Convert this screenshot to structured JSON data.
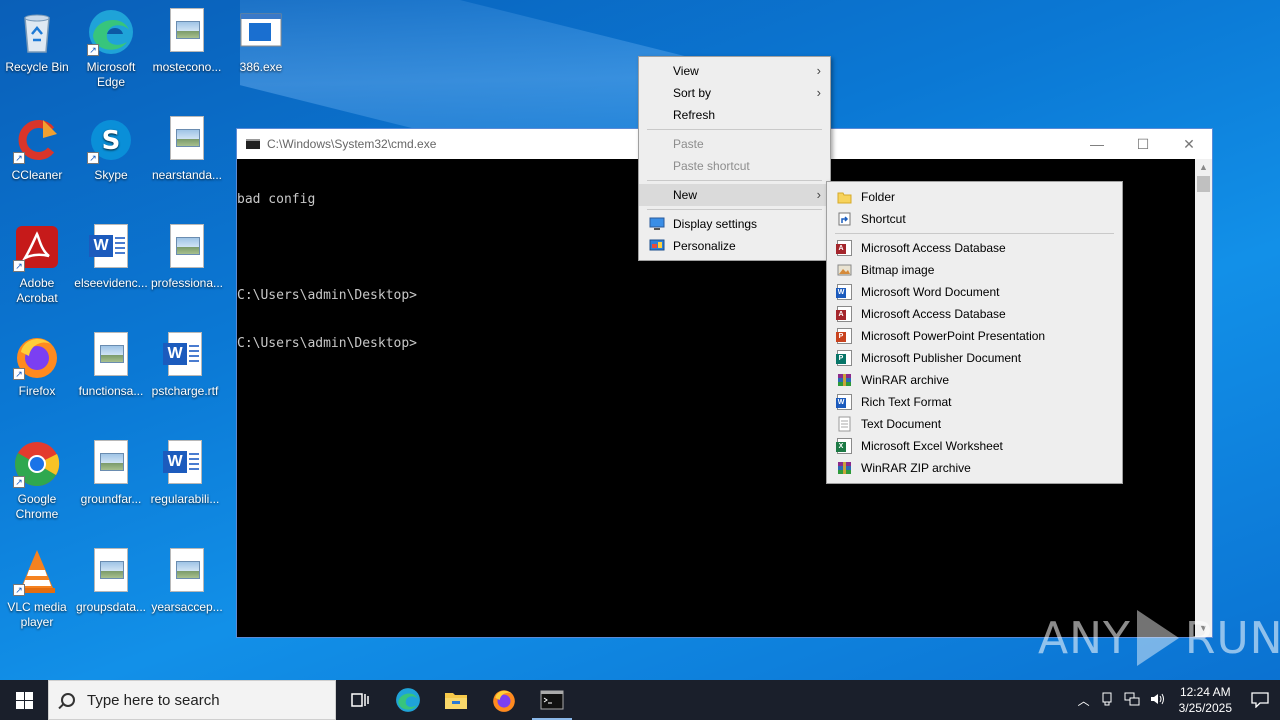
{
  "desktop": {
    "icons": [
      {
        "label": "Recycle Bin",
        "icon": "recycle-bin-icon"
      },
      {
        "label": "Microsoft Edge",
        "icon": "edge-icon"
      },
      {
        "label": "mostecono...",
        "icon": "image-file-icon"
      },
      {
        "label": "386.exe",
        "icon": "exe-window-icon"
      },
      {
        "label": "CCleaner",
        "icon": "ccleaner-icon"
      },
      {
        "label": "Skype",
        "icon": "skype-icon"
      },
      {
        "label": "nearstanda...",
        "icon": "image-file-icon"
      },
      {
        "label": "Adobe Acrobat",
        "icon": "acrobat-icon"
      },
      {
        "label": "elseevidenc...",
        "icon": "word-file-icon"
      },
      {
        "label": "professiona...",
        "icon": "image-file-icon"
      },
      {
        "label": "Firefox",
        "icon": "firefox-icon"
      },
      {
        "label": "functionsa...",
        "icon": "image-file-icon"
      },
      {
        "label": "pstcharge.rtf",
        "icon": "word-file-icon"
      },
      {
        "label": "Google Chrome",
        "icon": "chrome-icon"
      },
      {
        "label": "groundfar...",
        "icon": "image-file-icon"
      },
      {
        "label": "regularabili...",
        "icon": "word-file-icon"
      },
      {
        "label": "VLC media player",
        "icon": "vlc-icon"
      },
      {
        "label": "groupsdata...",
        "icon": "image-file-icon"
      },
      {
        "label": "yearsaccep...",
        "icon": "image-file-icon"
      }
    ]
  },
  "cmd": {
    "title": "C:\\Windows\\System32\\cmd.exe",
    "lines": [
      "bad config",
      "",
      "C:\\Users\\admin\\Desktop>",
      "C:\\Users\\admin\\Desktop>"
    ],
    "minimize": "—",
    "maximize": "☐",
    "close": "✕"
  },
  "context_menu": {
    "items": [
      {
        "label": "View",
        "submenu": true,
        "disabled": false
      },
      {
        "label": "Sort by",
        "submenu": true,
        "disabled": false
      },
      {
        "label": "Refresh",
        "submenu": false,
        "disabled": false
      },
      {
        "label": "Paste",
        "submenu": false,
        "disabled": true
      },
      {
        "label": "Paste shortcut",
        "submenu": false,
        "disabled": true
      },
      {
        "label": "New",
        "submenu": true,
        "disabled": false
      },
      {
        "label": "Display settings",
        "submenu": false,
        "disabled": false
      },
      {
        "label": "Personalize",
        "submenu": false,
        "disabled": false
      }
    ]
  },
  "new_submenu": {
    "items": [
      {
        "label": "Folder",
        "icon": "folder-icon"
      },
      {
        "label": "Shortcut",
        "icon": "shortcut-icon"
      },
      {
        "label": "Microsoft Access Database",
        "icon": "access-icon"
      },
      {
        "label": "Bitmap image",
        "icon": "bitmap-icon"
      },
      {
        "label": "Microsoft Word Document",
        "icon": "word-icon"
      },
      {
        "label": "Microsoft Access Database",
        "icon": "access-icon"
      },
      {
        "label": "Microsoft PowerPoint Presentation",
        "icon": "powerpoint-icon"
      },
      {
        "label": "Microsoft Publisher Document",
        "icon": "publisher-icon"
      },
      {
        "label": "WinRAR archive",
        "icon": "winrar-icon"
      },
      {
        "label": "Rich Text Format",
        "icon": "rtf-icon"
      },
      {
        "label": "Text Document",
        "icon": "text-document-icon"
      },
      {
        "label": "Microsoft Excel Worksheet",
        "icon": "excel-icon"
      },
      {
        "label": "WinRAR ZIP archive",
        "icon": "winrar-zip-icon"
      }
    ]
  },
  "watermark": {
    "left": "ANY",
    "right": "RUN"
  },
  "taskbar": {
    "search_placeholder": "Type here to search",
    "time": "12:24 AM",
    "date": "3/25/2025"
  },
  "colors": {
    "desktop_bg": "#0b78d4",
    "taskbar_bg": "#1a1f2b",
    "menu_bg": "#eeeeee",
    "cmd_bg": "#000000"
  }
}
